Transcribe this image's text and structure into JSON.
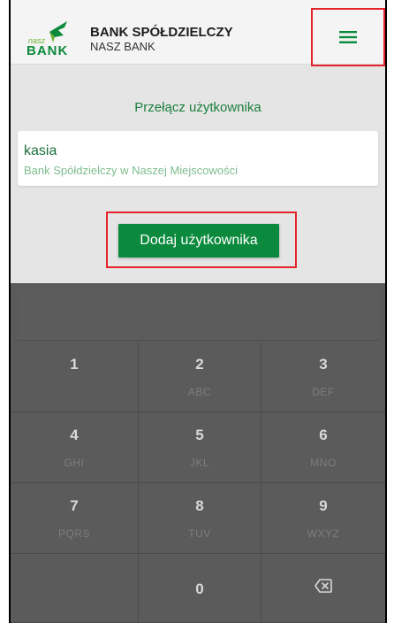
{
  "header": {
    "logo_small": "nasz",
    "logo_big": "BANK",
    "brand_name": "BANK SPÓŁDZIELCZY",
    "brand_sub": "NASZ BANK",
    "menu_icon": "hamburger-icon"
  },
  "switch_user": {
    "label": "Przełącz użytkownika"
  },
  "user": {
    "name": "kasia",
    "bank": "Bank Spółdzielczy w Naszej Miejscowości"
  },
  "add_user_button": "Dodaj użytkownika",
  "keypad": {
    "keys": [
      {
        "digit": "1",
        "letters": ""
      },
      {
        "digit": "2",
        "letters": "ABC"
      },
      {
        "digit": "3",
        "letters": "DEF"
      },
      {
        "digit": "4",
        "letters": "GHI"
      },
      {
        "digit": "5",
        "letters": "JKL"
      },
      {
        "digit": "6",
        "letters": "MNO"
      },
      {
        "digit": "7",
        "letters": "PQRS"
      },
      {
        "digit": "8",
        "letters": "TUV"
      },
      {
        "digit": "9",
        "letters": "WXYZ"
      }
    ],
    "zero": "0",
    "backspace_icon": "backspace-icon"
  },
  "colors": {
    "brand_green": "#0b8a3d",
    "highlight_red": "#e4232b"
  }
}
